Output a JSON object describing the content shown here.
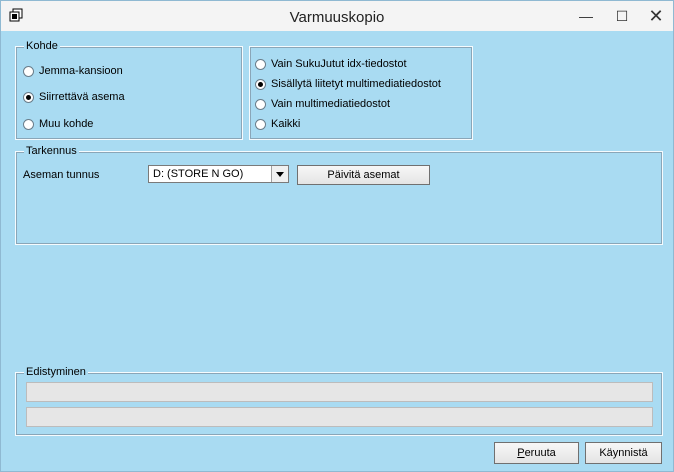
{
  "window": {
    "title": "Varmuuskopio",
    "app_icon": "backup-icon"
  },
  "titlebar": {
    "minimize_icon": "minimize-icon",
    "maximize_icon": "maximize-icon",
    "close_icon": "close-icon"
  },
  "target": {
    "legend": "Kohde",
    "options": [
      {
        "label": "Jemma-kansioon",
        "selected": false
      },
      {
        "label": "Siirrettävä asema",
        "selected": true
      },
      {
        "label": "Muu kohde",
        "selected": false
      }
    ]
  },
  "content": {
    "options": [
      {
        "label": "Vain SukuJutut idx-tiedostot",
        "selected": false
      },
      {
        "label": "Sisällytä liitetyt multimediatiedostot",
        "selected": true
      },
      {
        "label": "Vain multimediatiedostot",
        "selected": false
      },
      {
        "label": "Kaikki",
        "selected": false
      }
    ]
  },
  "details": {
    "legend": "Tarkennus",
    "drive_label": "Aseman tunnus",
    "drive_value": "D: (STORE N GO)",
    "refresh_button": "Päivitä asemat"
  },
  "progress": {
    "legend": "Edistyminen",
    "bar1_fraction": 0,
    "bar2_fraction": 0
  },
  "footer": {
    "cancel_prefix": "",
    "cancel_mnemonic": "P",
    "cancel_rest": "eruuta",
    "start_label": "Käynnistä"
  }
}
